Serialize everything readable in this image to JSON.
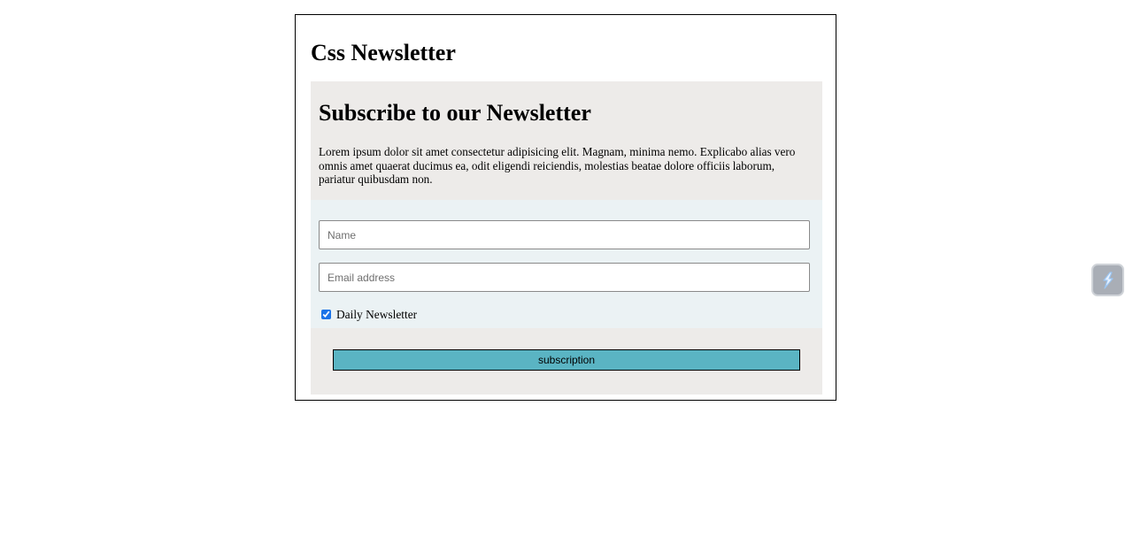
{
  "page": {
    "title": "Css Newsletter"
  },
  "newsletter": {
    "heading": "Subscribe to our Newsletter",
    "description": "Lorem ipsum dolor sit amet consectetur adipisicing elit. Magnam, minima nemo. Explicabo alias vero omnis amet quaerat ducimus ea, odit eligendi reiciendis, molestias beatae dolore officiis laborum, pariatur quibusdam non."
  },
  "form": {
    "name": {
      "value": "",
      "placeholder": "Name"
    },
    "email": {
      "value": "",
      "placeholder": "Email address"
    },
    "daily_newsletter": {
      "label": "Daily Newsletter",
      "checked": true
    },
    "submit_label": "subscription"
  },
  "extension_widget": {
    "icon": "lightning-bolt-icon"
  },
  "colors": {
    "header_bg": "#edebe9",
    "form_bg": "#ebf2f4",
    "button_bg": "#5ab4c3",
    "checkbox_accent": "#1a73e8"
  }
}
